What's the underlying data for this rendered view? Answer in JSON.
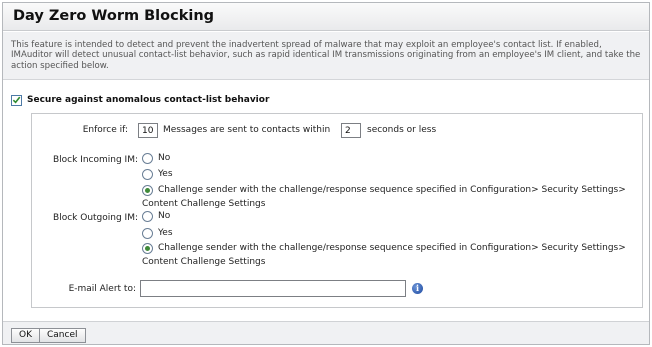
{
  "title": "Day Zero Worm Blocking",
  "description": "This feature is intended to detect and prevent the inadvertent spread of malware that may exploit an employee's contact list. If enabled, IMAuditor will detect unusual contact-list behavior, such as rapid identical IM transmissions originating from an employee's IM client, and take the action specified below.",
  "secure": {
    "label": "Secure against anomalous contact-list behavior",
    "checked": true
  },
  "enforce": {
    "label": "Enforce if:",
    "messages_value": "10",
    "middle_text": "Messages are sent to contacts within",
    "seconds_value": "2",
    "suffix_text": "seconds or less"
  },
  "block_incoming": {
    "label": "Block Incoming IM:",
    "options": [
      "No",
      "Yes",
      "Challenge sender with the challenge/response sequence specified in Configuration> Security Settings>"
    ],
    "option_continuation": "Content Challenge Settings",
    "selected_index": 2
  },
  "block_outgoing": {
    "label": "Block Outgoing IM:",
    "options": [
      "No",
      "Yes",
      "Challenge sender with the challenge/response sequence specified in Configuration> Security Settings>"
    ],
    "option_continuation": "Content Challenge Settings",
    "selected_index": 2
  },
  "email_alert": {
    "label": "E-mail Alert to:",
    "value": "",
    "icon": "info-icon"
  },
  "buttons": {
    "ok": "OK",
    "cancel": "Cancel"
  },
  "colors": {
    "check_mark": "#2f8a2f",
    "radio_selected": "#3f8a3a",
    "info_icon": "#1d4aa0"
  }
}
